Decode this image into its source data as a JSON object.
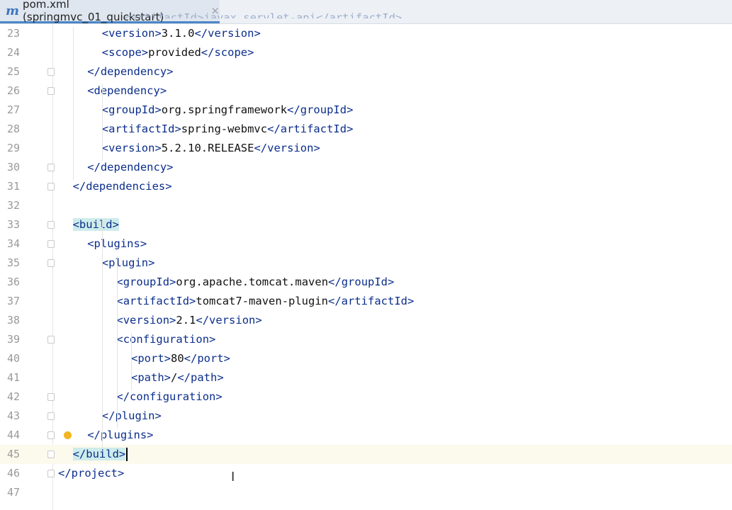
{
  "tab": {
    "icon": "m",
    "title": "pom.xml (springmvc_01_quickstart)",
    "close": "×"
  },
  "top_partial": "          <artifactId>javax.servlet-api</artifactId>",
  "lines": [
    {
      "n": "23",
      "indent": 3,
      "open": "version",
      "text": "3.1.0",
      "close": "version"
    },
    {
      "n": "24",
      "indent": 3,
      "open": "scope",
      "text": "provided",
      "close": "scope"
    },
    {
      "n": "25",
      "indent": 2,
      "end": "dependency"
    },
    {
      "n": "26",
      "indent": 2,
      "start": "dependency"
    },
    {
      "n": "27",
      "indent": 3,
      "open": "groupId",
      "text": "org.springframework",
      "close": "groupId"
    },
    {
      "n": "28",
      "indent": 3,
      "open": "artifactId",
      "text": "spring-webmvc",
      "close": "artifactId"
    },
    {
      "n": "29",
      "indent": 3,
      "open": "version",
      "text": "5.2.10.RELEASE",
      "close": "version"
    },
    {
      "n": "30",
      "indent": 2,
      "end": "dependency"
    },
    {
      "n": "31",
      "indent": 1,
      "end": "dependencies"
    },
    {
      "n": "32",
      "indent": 0
    },
    {
      "n": "33",
      "indent": 1,
      "start": "build",
      "highlight": true
    },
    {
      "n": "34",
      "indent": 2,
      "start": "plugins"
    },
    {
      "n": "35",
      "indent": 3,
      "start": "plugin"
    },
    {
      "n": "36",
      "indent": 4,
      "open": "groupId",
      "text": "org.apache.tomcat.maven",
      "close": "groupId"
    },
    {
      "n": "37",
      "indent": 4,
      "open": "artifactId",
      "text": "tomcat7-maven-plugin",
      "close": "artifactId"
    },
    {
      "n": "38",
      "indent": 4,
      "open": "version",
      "text": "2.1",
      "close": "version"
    },
    {
      "n": "39",
      "indent": 4,
      "start": "configuration"
    },
    {
      "n": "40",
      "indent": 5,
      "open": "port",
      "text": "80",
      "close": "port"
    },
    {
      "n": "41",
      "indent": 5,
      "open": "path",
      "text": "/",
      "close": "path"
    },
    {
      "n": "42",
      "indent": 4,
      "end": "configuration"
    },
    {
      "n": "43",
      "indent": 3,
      "end": "plugin"
    },
    {
      "n": "44",
      "indent": 2,
      "end": "plugins",
      "bulb": true
    },
    {
      "n": "45",
      "indent": 1,
      "end": "build",
      "highlight": true,
      "current": true,
      "cursor": true
    },
    {
      "n": "46",
      "indent": 0,
      "end": "project"
    },
    {
      "n": "47",
      "indent": 0
    }
  ]
}
